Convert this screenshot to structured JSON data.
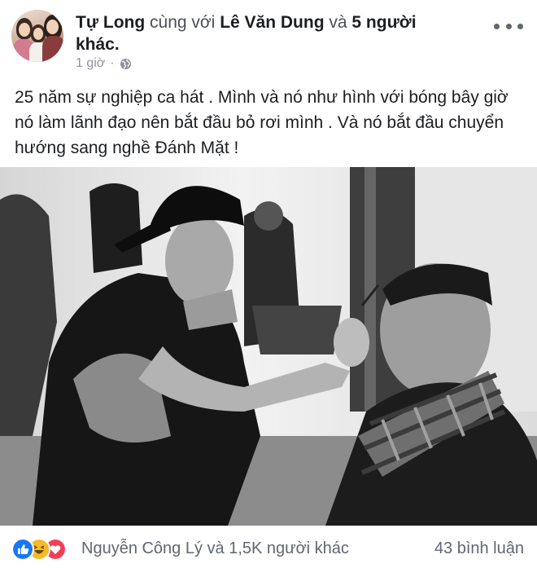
{
  "post": {
    "author": "Tự Long",
    "with_text": "cùng với",
    "tagged": "Lê Văn Dung",
    "and_text": "và",
    "others": "5 người khác",
    "period": ".",
    "time": "1 giờ",
    "separator": "·",
    "privacy_icon": "globe-icon",
    "text": "25 năm sự nghiệp ca hát . Mình và nó như hình với bóng bây giờ nó làm lãnh đạo nên bắt đầu bỏ rơi mình . Và nó bắt đầu chuyển hướng sang nghề Đánh Mặt !",
    "more_icon": "more-options-icon"
  },
  "photo": {
    "alt": "Black and white photo: man in cap applying makeup to an older man's face"
  },
  "footer": {
    "reaction_icons": [
      "like-icon",
      "haha-icon",
      "love-icon"
    ],
    "likes": "Nguyễn Công Lý và 1,5K người khác",
    "comments": "43 bình luận"
  },
  "colors": {
    "like": "#1877f2",
    "haha": "#f7b928",
    "love": "#f33e58",
    "secondary_text": "#606770"
  }
}
